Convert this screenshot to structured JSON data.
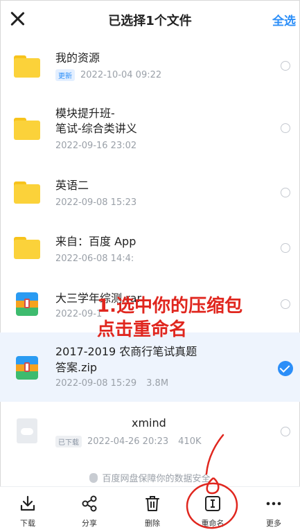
{
  "header": {
    "title": "已选择1个文件",
    "select_all": "全选"
  },
  "files": [
    {
      "icon": "folder-icon",
      "name_lines": [
        "我的资源"
      ],
      "badge": "更新",
      "date": "2022-10-04 09:22",
      "size": "",
      "selected": false
    },
    {
      "icon": "folder-icon",
      "name_lines": [
        "模块提升班-",
        "笔试-综合类讲义"
      ],
      "badge": "",
      "date": "2022-09-16 23:02",
      "size": "",
      "selected": false
    },
    {
      "icon": "folder-icon",
      "name_lines": [
        "英语二"
      ],
      "badge": "",
      "date": "2022-09-08 15:23",
      "size": "",
      "selected": false
    },
    {
      "icon": "folder-icon",
      "name_lines": [
        "来自：百度 App"
      ],
      "badge": "",
      "date": "2022-06-08 14:4:",
      "size": "",
      "selected": false
    },
    {
      "icon": "zip-icon",
      "name_lines": [
        "大三学年综测.rar"
      ],
      "badge": "",
      "date": "2022-09-1",
      "size": "",
      "selected": false
    },
    {
      "icon": "zip-icon",
      "name_lines": [
        "2017-2019 农商行笔试真题",
        "答案.zip"
      ],
      "badge": "",
      "date": "2022-09-08 15:29",
      "size": "3.8M",
      "selected": true
    },
    {
      "icon": "cloud-doc-icon",
      "name_lines": [
        "xmind"
      ],
      "badge": "已下载",
      "date": "2022-04-26 20:23",
      "size": "410K",
      "selected": false
    }
  ],
  "security_note": "百度网盘保障你的数据安全",
  "toolbar": [
    {
      "icon": "download-icon",
      "label": "下载"
    },
    {
      "icon": "share-icon",
      "label": "分享"
    },
    {
      "icon": "trash-icon",
      "label": "删除"
    },
    {
      "icon": "rename-icon",
      "label": "重命名"
    },
    {
      "icon": "more-icon",
      "label": "更多"
    }
  ],
  "annotation": {
    "line1": "1.选中你的压缩包",
    "line2": "点击重命名"
  },
  "colors": {
    "accent": "#2b8ef8",
    "annotation": "#e0261e",
    "folder": "#fbd23a"
  }
}
